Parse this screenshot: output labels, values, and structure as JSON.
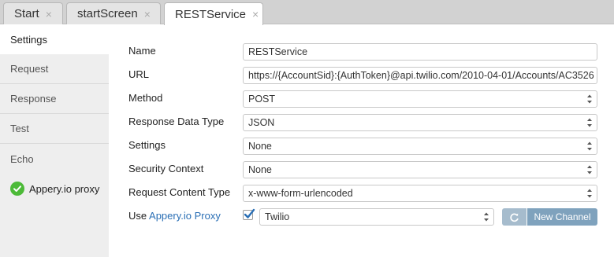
{
  "tabs": [
    {
      "label": "Start",
      "close": "×"
    },
    {
      "label": "startScreen",
      "close": "×"
    },
    {
      "label": "RESTService",
      "close": "×"
    }
  ],
  "sidebar": {
    "items": [
      {
        "label": "Settings"
      },
      {
        "label": "Request"
      },
      {
        "label": "Response"
      },
      {
        "label": "Test"
      },
      {
        "label": "Echo"
      },
      {
        "label": "Appery.io proxy"
      }
    ]
  },
  "form": {
    "name": {
      "label": "Name",
      "value": "RESTService"
    },
    "url": {
      "label": "URL",
      "value": "https://{AccountSid}:{AuthToken}@api.twilio.com/2010-04-01/Accounts/AC3526"
    },
    "method": {
      "label": "Method",
      "value": "POST"
    },
    "response_data_type": {
      "label": "Response Data Type",
      "value": "JSON"
    },
    "settings": {
      "label": "Settings",
      "value": "None"
    },
    "security_context": {
      "label": "Security Context",
      "value": "None"
    },
    "request_content_type": {
      "label": "Request Content Type",
      "value": "x-www-form-urlencoded"
    },
    "proxy": {
      "label_prefix": "Use",
      "label_link": "Appery.io Proxy",
      "checked": true,
      "value": "Twilio",
      "new_channel_label": "New Channel"
    }
  },
  "colors": {
    "accent_link": "#2a6fb5",
    "button": "#7fa2bd",
    "check_green": "#4cba38"
  }
}
